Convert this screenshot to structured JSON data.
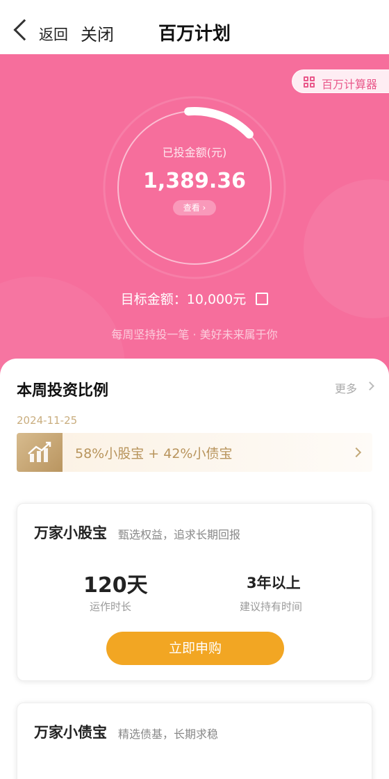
{
  "nav": {
    "back_label": "返回",
    "close_label": "关闭",
    "title": "百万计划"
  },
  "hero": {
    "calculator_label": "百万计算器",
    "calculator_icon": "grid-icon",
    "invested_label": "已投金额(元)",
    "invested_amount": "1,389.36",
    "invested_progress_fraction": 0.14,
    "view_label": "查看 ›",
    "target_label": "目标金额：10,000元",
    "edit_icon": "edit-icon",
    "slogan": "每周坚持投一笔 · 美好未来属于你",
    "background_color": "#f66e9c"
  },
  "weekly": {
    "title": "本周投资比例",
    "more_label": "更多",
    "date": "2024-11-25",
    "ratio_text": "58%小股宝 + 42%小债宝",
    "ratio_icon": "trend-chart-icon"
  },
  "funds": [
    {
      "name": "万家小股宝",
      "desc": "甄选权益，追求长期回报",
      "stat1_value": "120天",
      "stat1_label": "运作时长",
      "stat2_value": "3年以上",
      "stat2_label": "建议持有时间",
      "buy_label": "立即申购"
    },
    {
      "name": "万家小债宝",
      "desc": "精选债基，长期求稳"
    }
  ],
  "colors": {
    "accent_pink": "#f66e9c",
    "gold_text": "#b8945c",
    "buy_button": "#f2a623"
  }
}
